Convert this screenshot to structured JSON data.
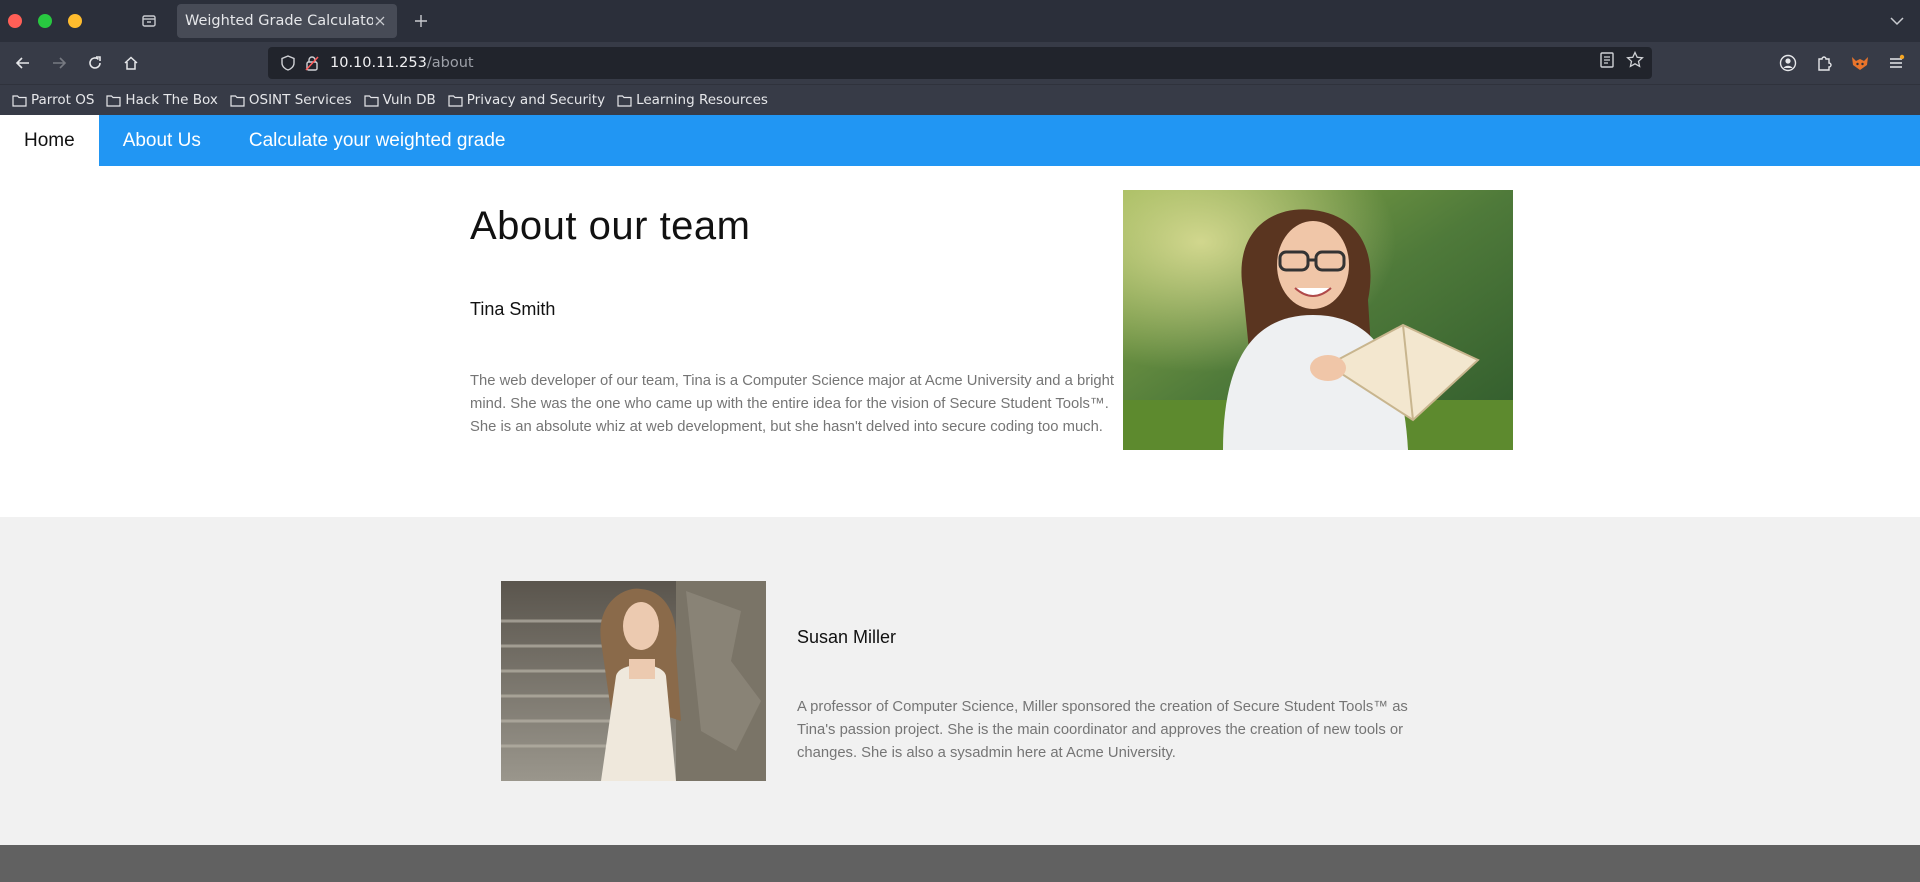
{
  "browser": {
    "tab": {
      "title": "Weighted Grade Calculator"
    },
    "url": {
      "host": "10.10.11.253",
      "path": "/about"
    },
    "bookmarks": [
      {
        "label": "Parrot OS"
      },
      {
        "label": "Hack The Box"
      },
      {
        "label": "OSINT Services"
      },
      {
        "label": "Vuln DB"
      },
      {
        "label": "Privacy and Security"
      },
      {
        "label": "Learning Resources"
      }
    ]
  },
  "site": {
    "nav": [
      {
        "label": "Home",
        "active": true
      },
      {
        "label": "About Us",
        "active": false
      },
      {
        "label": "Calculate your weighted grade",
        "active": false
      }
    ],
    "heading": "About our team",
    "members": [
      {
        "name": "Tina Smith",
        "description": "The web developer of our team, Tina is a Computer Science major at Acme University and a bright mind. She was the one who came up with the entire idea for the vision of Secure Student Tools™. She is an absolute whiz at web development, but she hasn't delved into secure coding too much."
      },
      {
        "name": "Susan Miller",
        "description": "A professor of Computer Science, Miller sponsored the creation of Secure Student Tools™ as Tina's passion project. She is the main coordinator and approves the creation of new tools or changes. She is also a sysadmin here at Acme University."
      }
    ]
  },
  "colors": {
    "nav_bar": "#2196f3",
    "section_alt_bg": "#f1f1f1",
    "footer_bg": "#616161",
    "body_text": "#757575"
  }
}
